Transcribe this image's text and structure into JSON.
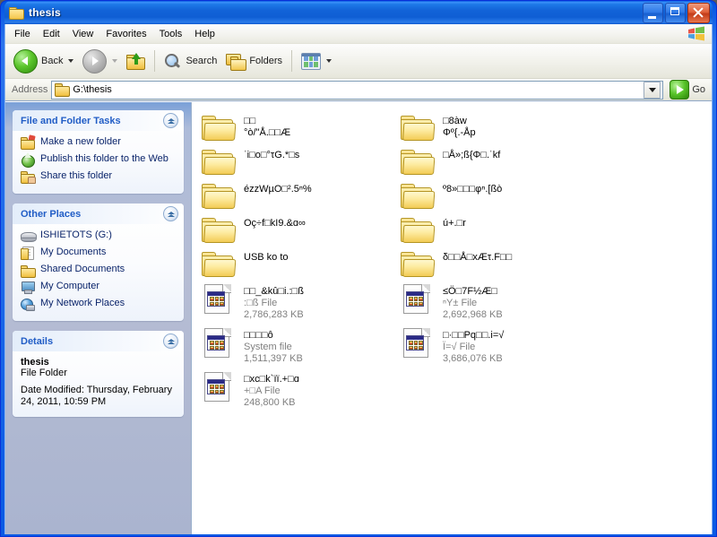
{
  "window": {
    "title": "thesis",
    "title_icon": "folder-icon",
    "buttons": {
      "minimize": "minimize-button",
      "maximize": "maximize-button",
      "close": "close-button"
    }
  },
  "menu": {
    "items": [
      {
        "label": "File"
      },
      {
        "label": "Edit"
      },
      {
        "label": "View"
      },
      {
        "label": "Favorites"
      },
      {
        "label": "Tools"
      },
      {
        "label": "Help"
      }
    ]
  },
  "toolbar": {
    "back_label": "Back",
    "search_label": "Search",
    "folders_label": "Folders"
  },
  "address": {
    "label": "Address",
    "value": "G:\\thesis",
    "go_label": "Go"
  },
  "sidebar": {
    "tasks_panel": {
      "title": "File and Folder Tasks",
      "items": [
        {
          "label": "Make a new folder",
          "icon": "new-folder-icon"
        },
        {
          "label": "Publish this folder to the Web",
          "icon": "publish-web-icon"
        },
        {
          "label": "Share this folder",
          "icon": "share-folder-icon"
        }
      ]
    },
    "places_panel": {
      "title": "Other Places",
      "items": [
        {
          "label": "ISHIETOTS (G:)",
          "icon": "drive-icon"
        },
        {
          "label": "My Documents",
          "icon": "my-documents-icon"
        },
        {
          "label": "Shared Documents",
          "icon": "shared-documents-icon"
        },
        {
          "label": "My Computer",
          "icon": "my-computer-icon"
        },
        {
          "label": "My Network Places",
          "icon": "network-places-icon"
        }
      ]
    },
    "details_panel": {
      "title": "Details",
      "name": "thesis",
      "type": "File Folder",
      "date_modified": "Date Modified: Thursday, February 24, 2011, 10:59 PM"
    }
  },
  "files": {
    "entries": [
      {
        "name": "□□\n°ò/\"Å.□□Æ",
        "kind": "folder",
        "type": "",
        "size": ""
      },
      {
        "name": "□8àw\nΦº{.-Åp",
        "kind": "folder",
        "type": "",
        "size": ""
      },
      {
        "name": "ˈi□o□°τG.*□s",
        "kind": "folder",
        "type": "",
        "size": ""
      },
      {
        "name": "□Å»;ß{Φ□.ˈkf",
        "kind": "folder",
        "type": "",
        "size": ""
      },
      {
        "name": "ézzWµO□².5ⁿ%",
        "kind": "folder",
        "type": "",
        "size": ""
      },
      {
        "name": "º8»□□□φⁿ.[ßò",
        "kind": "folder",
        "type": "",
        "size": ""
      },
      {
        "name": "Oç÷f□kI9.&ɑ∞",
        "kind": "folder",
        "type": "",
        "size": ""
      },
      {
        "name": "ú+.□r",
        "kind": "folder",
        "type": "",
        "size": ""
      },
      {
        "name": "USB ko to",
        "kind": "folder",
        "type": "",
        "size": ""
      },
      {
        "name": "δ□□Å□xÆτ.F□□",
        "kind": "folder",
        "type": "",
        "size": ""
      },
      {
        "name": "□□_&kû□i.:□ß",
        "kind": "file",
        "type": ":□ß File",
        "size": "2,786,283 KB"
      },
      {
        "name": "≤Ö□7F½Æ□",
        "kind": "file",
        "type": "ⁿY± File",
        "size": "2,692,968 KB"
      },
      {
        "name": "□□□□ô",
        "kind": "file",
        "type": "System file",
        "size": "1,511,397 KB"
      },
      {
        "name": "□·□□Pq□□.i=√",
        "kind": "file",
        "type": "Ï=√ File",
        "size": "3,686,076 KB"
      },
      {
        "name": "□xc□k`ïï.+□ɑ",
        "kind": "file",
        "type": "+□A File",
        "size": "248,800 KB"
      }
    ]
  }
}
